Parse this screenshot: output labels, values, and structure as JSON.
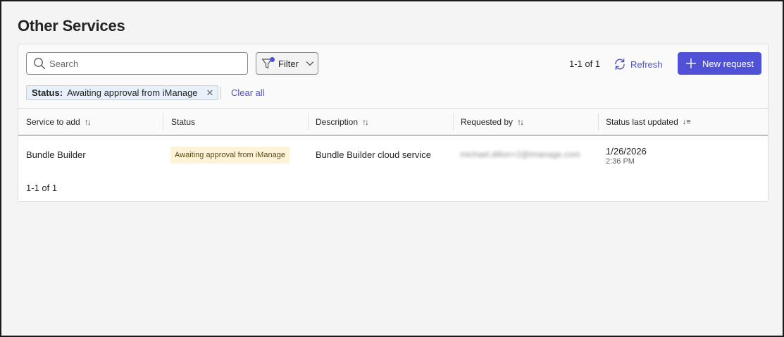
{
  "page": {
    "title": "Other Services"
  },
  "toolbar": {
    "search_placeholder": "Search",
    "search_value": "",
    "filter_label": "Filter",
    "count_label": "1-1 of 1",
    "refresh_label": "Refresh",
    "new_request_label": "New request"
  },
  "filters": {
    "chips": [
      {
        "key": "Status:",
        "value": "Awaiting approval from iManage"
      }
    ],
    "clear_all_label": "Clear all"
  },
  "table": {
    "columns": [
      {
        "label": "Service to add",
        "sort": "sortable"
      },
      {
        "label": "Status",
        "sort": "none"
      },
      {
        "label": "Description",
        "sort": "sortable"
      },
      {
        "label": "Requested by",
        "sort": "sortable"
      },
      {
        "label": "Status last updated",
        "sort": "descending"
      }
    ],
    "rows": [
      {
        "service": "Bundle Builder",
        "status": "Awaiting approval from iManage",
        "description": "Bundle Builder cloud service",
        "requested_by": "michael.dillon+2@imanage.com",
        "updated_date": "1/26/2026",
        "updated_time": "2:36 PM"
      }
    ],
    "footer_count": "1-1 of 1"
  },
  "colors": {
    "accent": "#4f52d6",
    "link": "#4f52c8",
    "chip_bg": "#e8f1fa",
    "status_pill_bg": "#fdf3d8"
  },
  "icons": {
    "search": "search-icon",
    "filter": "filter-icon",
    "chevron": "chevron-down-icon",
    "refresh": "refresh-icon",
    "add": "plus-icon",
    "close": "close-icon",
    "sort": "sort-icon"
  }
}
